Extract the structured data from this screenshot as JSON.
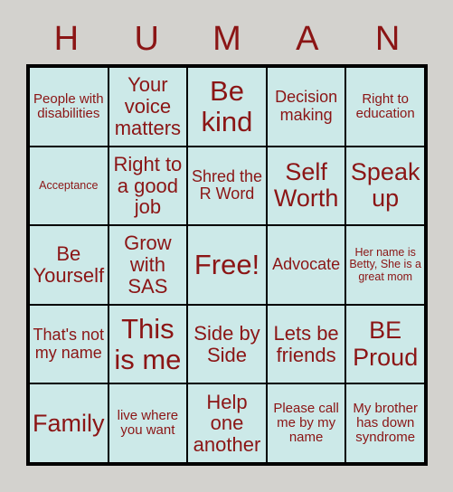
{
  "card": {
    "title_letters": [
      "H",
      "U",
      "M",
      "A",
      "N"
    ],
    "accent_color": "#8b1515",
    "cell_background": "#cce9e8",
    "page_background": "#d3d2ce",
    "border_color": "#000000",
    "columns": 5,
    "rows": 5
  },
  "cells": [
    {
      "text": "People with disabilities",
      "size": "fs-s"
    },
    {
      "text": "Your voice matters",
      "size": "fs-l"
    },
    {
      "text": "Be kind",
      "size": "fs-xxl"
    },
    {
      "text": "Decision making",
      "size": "fs-m"
    },
    {
      "text": "Right to education",
      "size": "fs-s"
    },
    {
      "text": "Acceptance",
      "size": "fs-xs"
    },
    {
      "text": "Right to a good job",
      "size": "fs-l"
    },
    {
      "text": "Shred the R Word",
      "size": "fs-m"
    },
    {
      "text": "Self Worth",
      "size": "fs-xl"
    },
    {
      "text": "Speak up",
      "size": "fs-xl"
    },
    {
      "text": "Be Yourself",
      "size": "fs-l"
    },
    {
      "text": "Grow with SAS",
      "size": "fs-l"
    },
    {
      "text": "Free!",
      "size": "fs-xxl"
    },
    {
      "text": "Advocate",
      "size": "fs-m"
    },
    {
      "text": "Her name is Betty, She is a great mom",
      "size": "fs-xs"
    },
    {
      "text": "That's not my name",
      "size": "fs-m"
    },
    {
      "text": "This is me",
      "size": "fs-xxl"
    },
    {
      "text": "Side by Side",
      "size": "fs-l"
    },
    {
      "text": "Lets be friends",
      "size": "fs-l"
    },
    {
      "text": "BE Proud",
      "size": "fs-xl"
    },
    {
      "text": "Family",
      "size": "fs-xl"
    },
    {
      "text": "live where you want",
      "size": "fs-s"
    },
    {
      "text": "Help one another",
      "size": "fs-l"
    },
    {
      "text": "Please call me by my name",
      "size": "fs-s"
    },
    {
      "text": "My brother has down syndrome",
      "size": "fs-s"
    }
  ]
}
